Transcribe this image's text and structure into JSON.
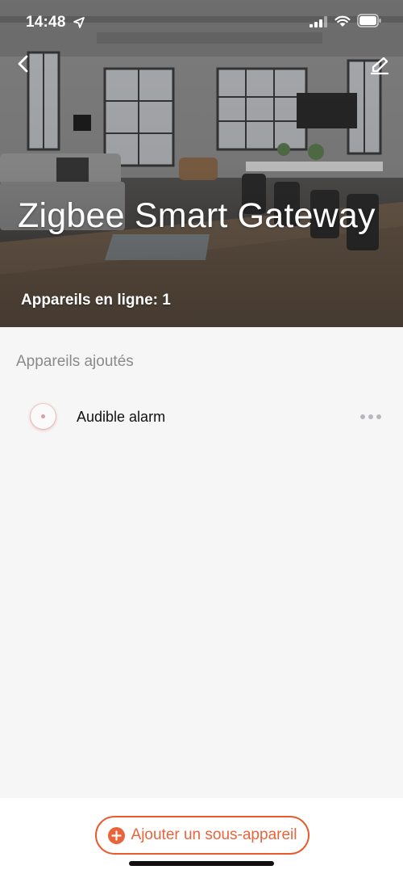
{
  "status_bar": {
    "time": "14:48",
    "icons": [
      "location-arrow-icon",
      "cellular-signal-icon",
      "wifi-icon",
      "battery-icon"
    ]
  },
  "header": {
    "back_icon": "chevron-left-icon",
    "edit_icon": "pencil-icon",
    "title": "Zigbee Smart Gateway",
    "online_devices": "Appareils en ligne: 1"
  },
  "section": {
    "title": "Appareils ajoutés"
  },
  "devices": [
    {
      "name": "Audible alarm",
      "icon": "alarm-device-icon",
      "more_icon": "ellipsis-icon"
    }
  ],
  "footer": {
    "add_label": "Ajouter un sous-appareil",
    "add_icon": "plus-circle-icon"
  },
  "colors": {
    "accent": "#e8643a",
    "background": "#f6f6f6",
    "muted_text": "#8a8a8e"
  }
}
